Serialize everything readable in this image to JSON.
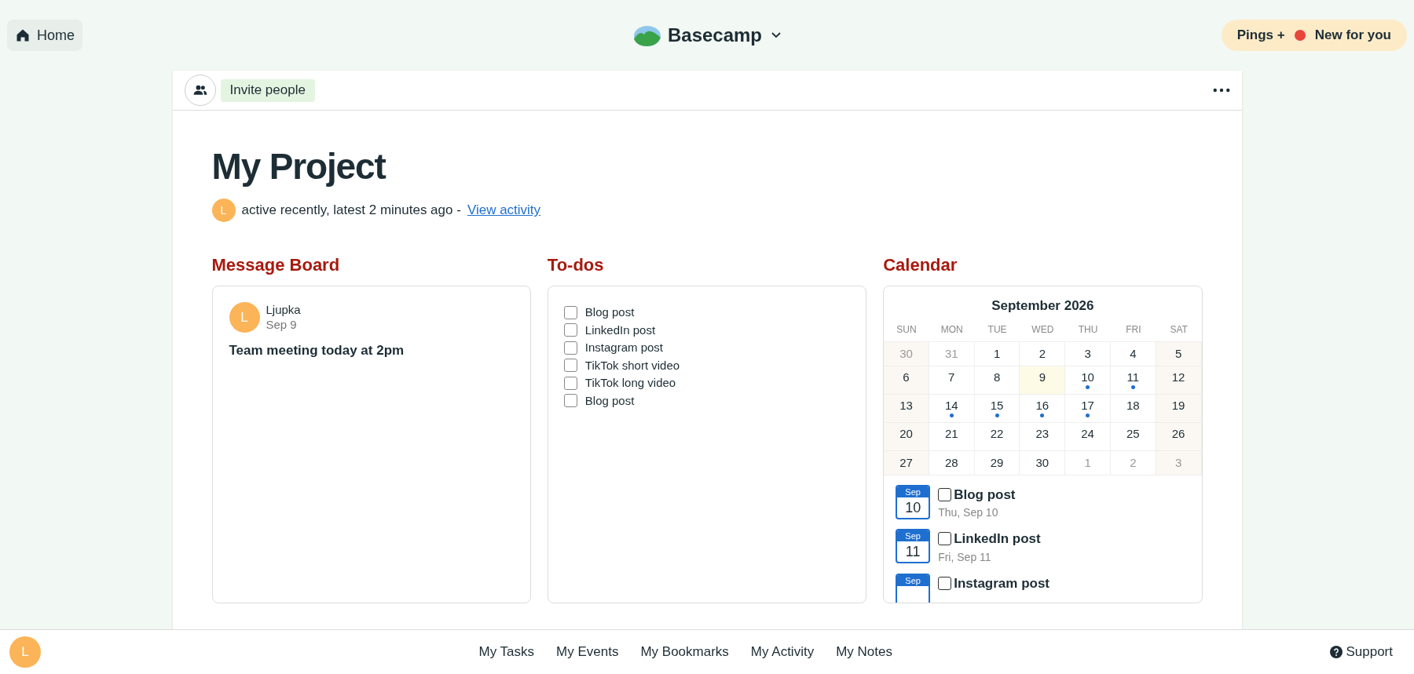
{
  "topbar": {
    "home": "Home",
    "brand": "Basecamp",
    "pings": "Pings +",
    "new_for_you": "New for you"
  },
  "project": {
    "invite": "Invite people",
    "title": "My Project",
    "avatar": "L",
    "activity": "active recently, latest 2 minutes ago -",
    "activity_link": "View activity"
  },
  "message_board": {
    "title": "Message Board",
    "messages": [
      {
        "avatar": "L",
        "author": "Ljupka",
        "date": "Sep 9",
        "subject": "Team meeting today at 2pm"
      }
    ]
  },
  "todos": {
    "title": "To-dos",
    "items": [
      {
        "label": "Blog post",
        "checked": false
      },
      {
        "label": "LinkedIn post",
        "checked": false
      },
      {
        "label": "Instagram post",
        "checked": false
      },
      {
        "label": "TikTok short video",
        "checked": false
      },
      {
        "label": "TikTok long video",
        "checked": false
      },
      {
        "label": "Blog post",
        "checked": false
      }
    ]
  },
  "calendar": {
    "title": "Calendar",
    "month": "September 2026",
    "weekdays": [
      "SUN",
      "MON",
      "TUE",
      "WED",
      "THU",
      "FRI",
      "SAT"
    ],
    "weeks": [
      [
        {
          "day": "30",
          "muted": true,
          "dot": false,
          "today": false
        },
        {
          "day": "31",
          "muted": true,
          "dot": false,
          "today": false
        },
        {
          "day": "1",
          "muted": false,
          "dot": false,
          "today": false
        },
        {
          "day": "2",
          "muted": false,
          "dot": false,
          "today": false
        },
        {
          "day": "3",
          "muted": false,
          "dot": false,
          "today": false
        },
        {
          "day": "4",
          "muted": false,
          "dot": false,
          "today": false
        },
        {
          "day": "5",
          "muted": false,
          "dot": false,
          "today": false
        }
      ],
      [
        {
          "day": "6",
          "muted": false,
          "dot": false,
          "today": false
        },
        {
          "day": "7",
          "muted": false,
          "dot": false,
          "today": false
        },
        {
          "day": "8",
          "muted": false,
          "dot": false,
          "today": false
        },
        {
          "day": "9",
          "muted": false,
          "dot": false,
          "today": true
        },
        {
          "day": "10",
          "muted": false,
          "dot": true,
          "today": false
        },
        {
          "day": "11",
          "muted": false,
          "dot": true,
          "today": false
        },
        {
          "day": "12",
          "muted": false,
          "dot": false,
          "today": false
        }
      ],
      [
        {
          "day": "13",
          "muted": false,
          "dot": false,
          "today": false
        },
        {
          "day": "14",
          "muted": false,
          "dot": true,
          "today": false
        },
        {
          "day": "15",
          "muted": false,
          "dot": true,
          "today": false
        },
        {
          "day": "16",
          "muted": false,
          "dot": true,
          "today": false
        },
        {
          "day": "17",
          "muted": false,
          "dot": true,
          "today": false
        },
        {
          "day": "18",
          "muted": false,
          "dot": false,
          "today": false
        },
        {
          "day": "19",
          "muted": false,
          "dot": false,
          "today": false
        }
      ],
      [
        {
          "day": "20",
          "muted": false,
          "dot": false,
          "today": false
        },
        {
          "day": "21",
          "muted": false,
          "dot": false,
          "today": false
        },
        {
          "day": "22",
          "muted": false,
          "dot": false,
          "today": false
        },
        {
          "day": "23",
          "muted": false,
          "dot": false,
          "today": false
        },
        {
          "day": "24",
          "muted": false,
          "dot": false,
          "today": false
        },
        {
          "day": "25",
          "muted": false,
          "dot": false,
          "today": false
        },
        {
          "day": "26",
          "muted": false,
          "dot": false,
          "today": false
        }
      ],
      [
        {
          "day": "27",
          "muted": false,
          "dot": false,
          "today": false
        },
        {
          "day": "28",
          "muted": false,
          "dot": false,
          "today": false
        },
        {
          "day": "29",
          "muted": false,
          "dot": false,
          "today": false
        },
        {
          "day": "30",
          "muted": false,
          "dot": false,
          "today": false
        },
        {
          "day": "1",
          "muted": true,
          "dot": false,
          "today": false
        },
        {
          "day": "2",
          "muted": true,
          "dot": false,
          "today": false
        },
        {
          "day": "3",
          "muted": true,
          "dot": false,
          "today": false
        }
      ]
    ],
    "events": [
      {
        "month": "Sep",
        "day": "10",
        "title": "Blog post",
        "date": "Thu, Sep 10",
        "checked": false
      },
      {
        "month": "Sep",
        "day": "11",
        "title": "LinkedIn post",
        "date": "Fri, Sep 11",
        "checked": false
      },
      {
        "month": "Sep",
        "title": "Instagram post",
        "checked": false
      }
    ]
  },
  "bottombar": {
    "avatar": "L",
    "links": [
      "My Tasks",
      "My Events",
      "My Bookmarks",
      "My Activity",
      "My Notes"
    ],
    "support": "Support"
  }
}
